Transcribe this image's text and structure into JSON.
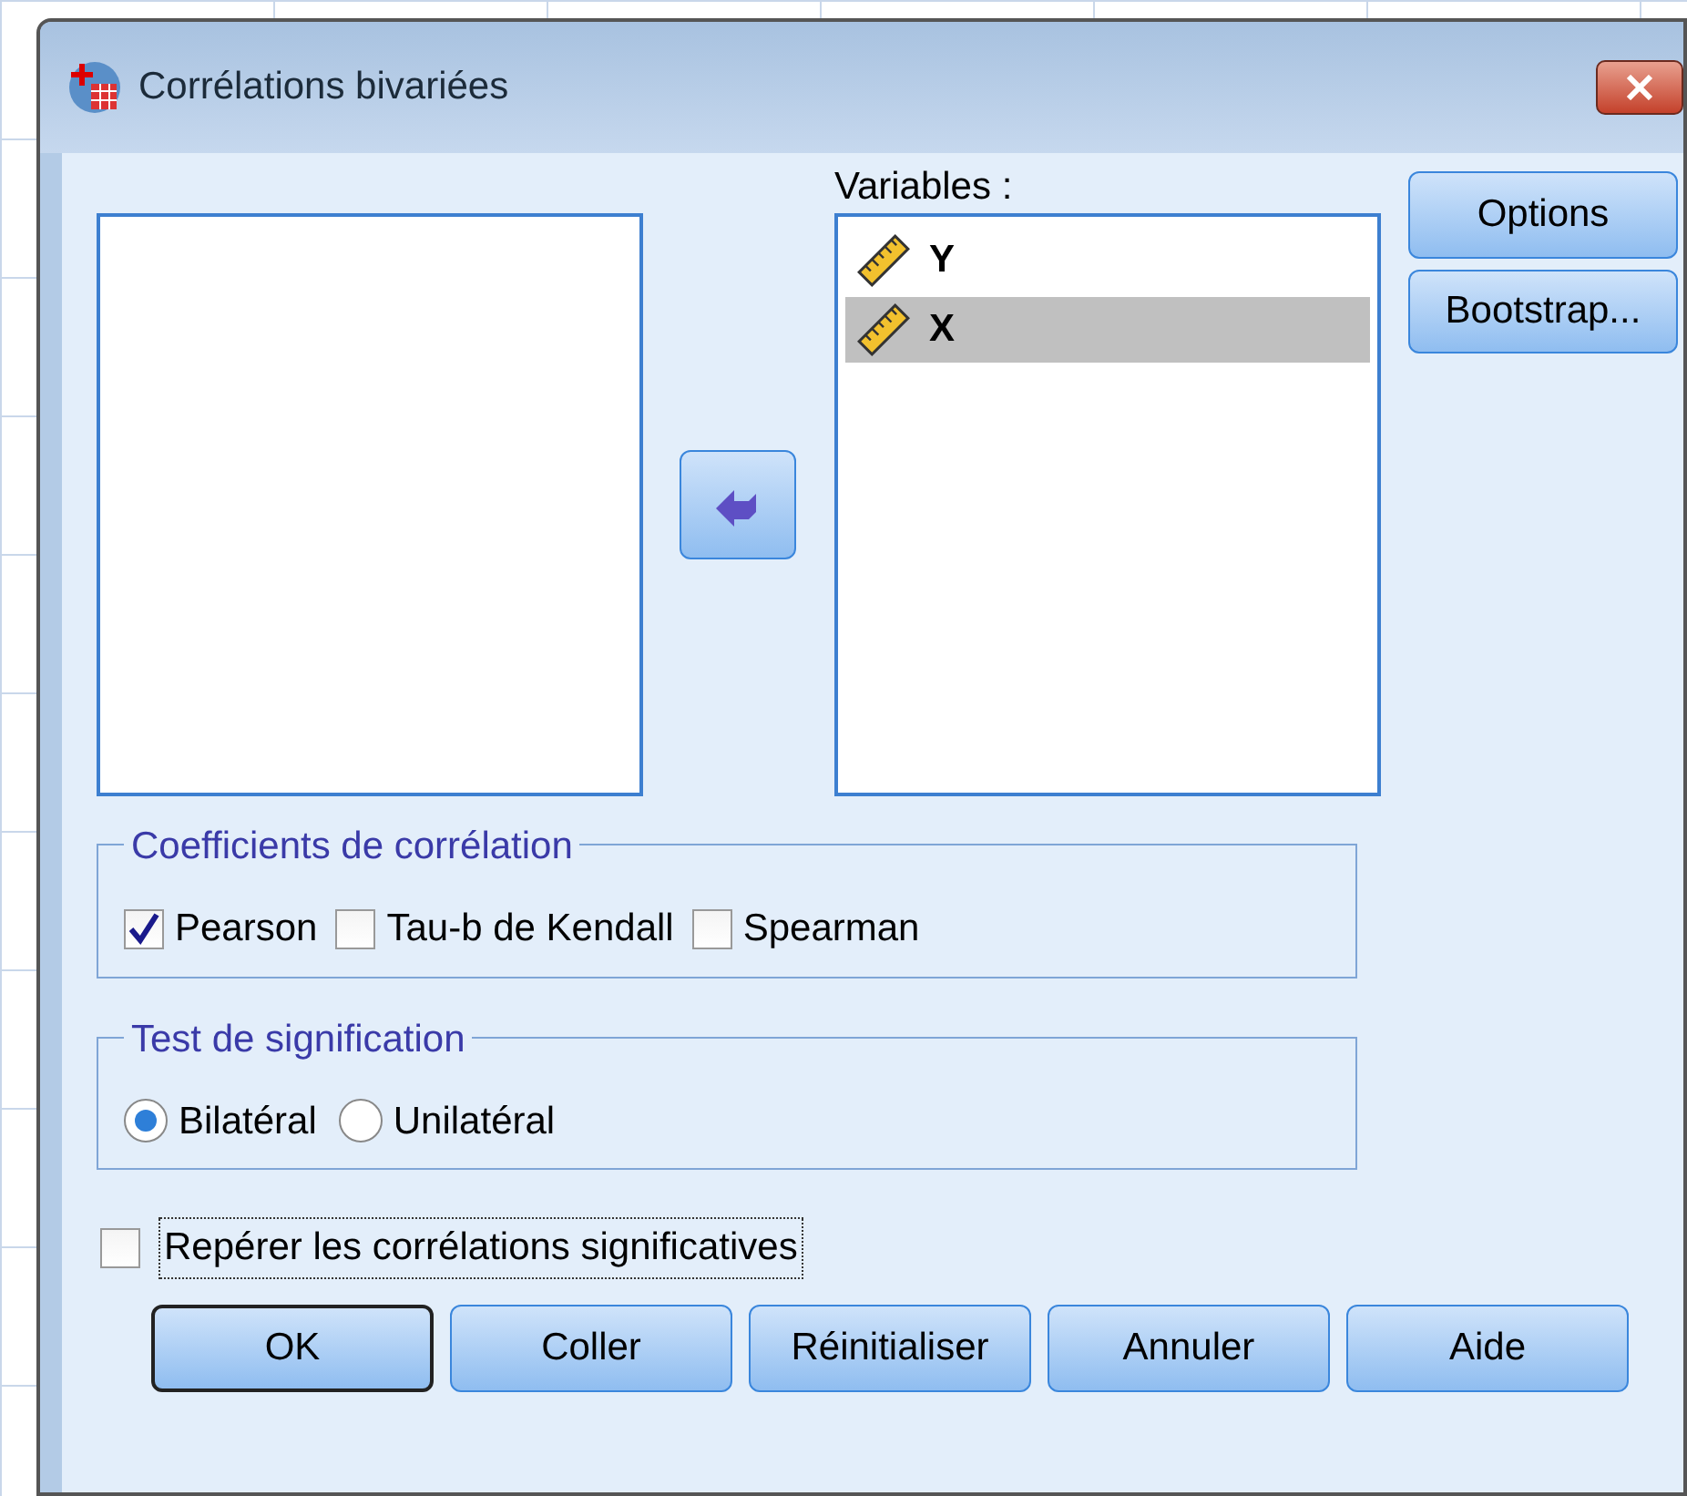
{
  "window": {
    "title": "Corrélations bivariées"
  },
  "variables": {
    "label": "Variables :",
    "items": [
      {
        "name": "Y",
        "selected": false
      },
      {
        "name": "X",
        "selected": true
      }
    ]
  },
  "side_buttons": [
    "Options",
    "Bootstrap..."
  ],
  "coefficients": {
    "title": "Coefficients de corrélation",
    "options": [
      {
        "label": "Pearson",
        "checked": true
      },
      {
        "label": "Tau-b de Kendall",
        "checked": false
      },
      {
        "label": "Spearman",
        "checked": false
      }
    ]
  },
  "significance": {
    "title": "Test de signification",
    "options": [
      {
        "label": "Bilatéral",
        "selected": true
      },
      {
        "label": "Unilatéral",
        "selected": false
      }
    ]
  },
  "flag_significant": {
    "label": "Repérer les corrélations significatives",
    "checked": false
  },
  "buttons": [
    {
      "label": "OK",
      "default": true
    },
    {
      "label": "Coller",
      "default": false
    },
    {
      "label": "Réinitialiser",
      "default": false
    },
    {
      "label": "Annuler",
      "default": false
    },
    {
      "label": "Aide",
      "default": false
    }
  ]
}
